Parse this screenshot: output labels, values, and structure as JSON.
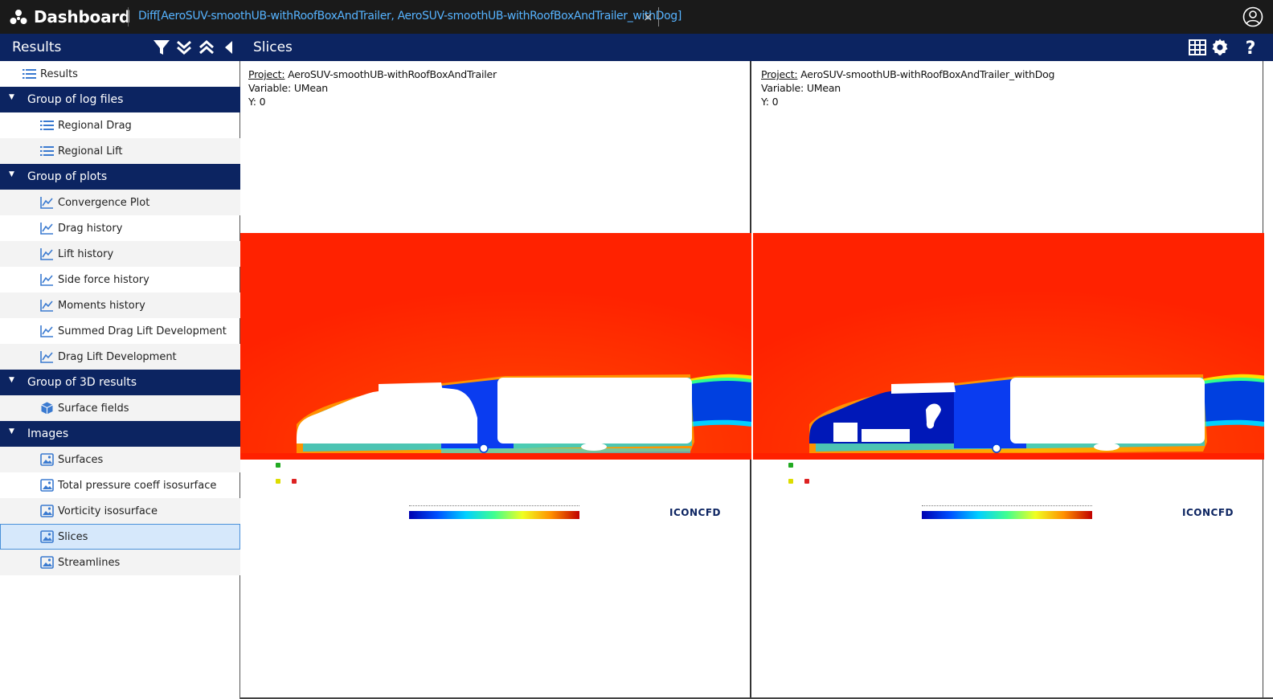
{
  "topbar": {
    "app_title": "Dashboard",
    "tab_label": "Diff[AeroSUV-smoothUB-withRoofBoxAndTrailer, AeroSUV-smoothUB-withRoofBoxAndTrailer_withDog]",
    "tab_close": "×",
    "icons": [
      "logo-icon",
      "user-account-icon"
    ]
  },
  "header": {
    "left_title": "Results",
    "main_title": "Slices",
    "left_icons": [
      "filter-icon",
      "expand-all-icon",
      "collapse-all-icon",
      "collapse-sidebar-icon"
    ],
    "right_icons": [
      "grid-layout-icon",
      "gear-icon",
      "help-icon"
    ]
  },
  "sidebar": {
    "root": "Results",
    "groups": [
      {
        "label": "Group of log files",
        "items": [
          {
            "label": "Regional Drag",
            "icon": "list-icon"
          },
          {
            "label": "Regional Lift",
            "icon": "list-icon"
          }
        ]
      },
      {
        "label": "Group of plots",
        "items": [
          {
            "label": "Convergence Plot",
            "icon": "line-chart-icon"
          },
          {
            "label": "Drag history",
            "icon": "line-chart-icon"
          },
          {
            "label": "Lift history",
            "icon": "line-chart-icon"
          },
          {
            "label": "Side force history",
            "icon": "line-chart-icon"
          },
          {
            "label": "Moments history",
            "icon": "line-chart-icon"
          },
          {
            "label": "Summed Drag Lift Development",
            "icon": "line-chart-icon"
          },
          {
            "label": "Drag Lift Development",
            "icon": "line-chart-icon"
          }
        ]
      },
      {
        "label": "Group of 3D results",
        "items": [
          {
            "label": "Surface fields",
            "icon": "cube-icon"
          }
        ]
      },
      {
        "label": "Images",
        "items": [
          {
            "label": "Surfaces",
            "icon": "image-icon"
          },
          {
            "label": "Total pressure coeff isosurface",
            "icon": "image-icon"
          },
          {
            "label": "Vorticity isosurface",
            "icon": "image-icon"
          },
          {
            "label": "Slices",
            "icon": "image-icon",
            "selected": true
          },
          {
            "label": "Streamlines",
            "icon": "image-icon"
          }
        ]
      }
    ]
  },
  "panels": [
    {
      "project_label": "Project:",
      "project": "AeroSUV-smoothUB-withRoofBoxAndTrailer",
      "variable_label": "Variable:",
      "variable": "UMean",
      "y_label": "Y:",
      "y": "0",
      "colorbar_colors": [
        "#0000b0",
        "#0040ff",
        "#00c0ff",
        "#30ffc0",
        "#c0ff30",
        "#ffc000",
        "#ff4000",
        "#c00000"
      ],
      "brand": "ICONCFD"
    },
    {
      "project_label": "Project:",
      "project": "AeroSUV-smoothUB-withRoofBoxAndTrailer_withDog",
      "variable_label": "Variable:",
      "variable": "UMean",
      "y_label": "Y:",
      "y": "0",
      "colorbar_colors": [
        "#0000b0",
        "#0040ff",
        "#00c0ff",
        "#30ffc0",
        "#c0ff30",
        "#ffc000",
        "#ff4000",
        "#c00000"
      ],
      "brand": "ICONCFD"
    }
  ],
  "colors": {
    "topbar": "#1a1a1a",
    "header": "#0c2461",
    "tab_text": "#56b3ff",
    "flow_free": "#ff2a00",
    "flow_slow": "#0020c0"
  }
}
